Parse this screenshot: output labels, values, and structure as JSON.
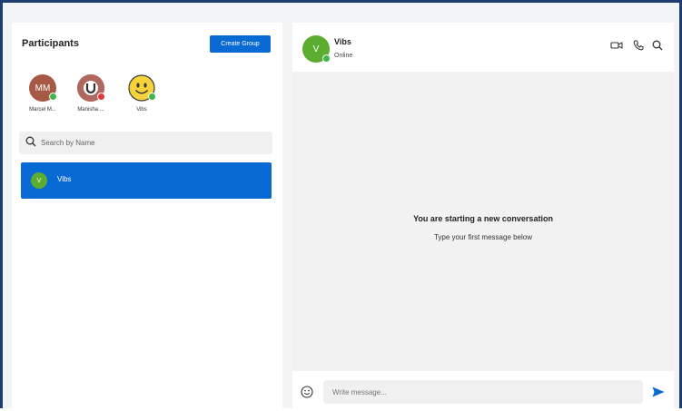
{
  "participants_panel": {
    "title": "Participants",
    "create_group_label": "Create Group",
    "participants": [
      {
        "initials": "MM",
        "name": "Marcel M...",
        "status": "online",
        "avatar_color": "#a65a45"
      },
      {
        "initials": "",
        "name": "Manisha ...",
        "status": "busy",
        "avatar_color": "#b06a60"
      },
      {
        "initials": "",
        "name": "Vibs",
        "status": "online",
        "avatar_color": "#f6d23b"
      }
    ],
    "search": {
      "placeholder": "Search by Name",
      "value": ""
    },
    "contacts": [
      {
        "initials": "V",
        "name": "Vibs",
        "selected": true
      }
    ]
  },
  "chat": {
    "contact_initials": "V",
    "contact_name": "Vibs",
    "contact_status": "Online",
    "header_icons": [
      "video-call-icon",
      "phone-icon",
      "search-icon"
    ],
    "empty_title": "You are starting a new conversation",
    "empty_subtitle": "Type your first message below",
    "message_placeholder": "Write message...",
    "message_value": ""
  },
  "colors": {
    "accent": "#0a6ad4",
    "online": "#3fb54a",
    "busy": "#e03a3a",
    "frame_border": "#1f3d6e",
    "avatar_green": "#5aad2e"
  }
}
